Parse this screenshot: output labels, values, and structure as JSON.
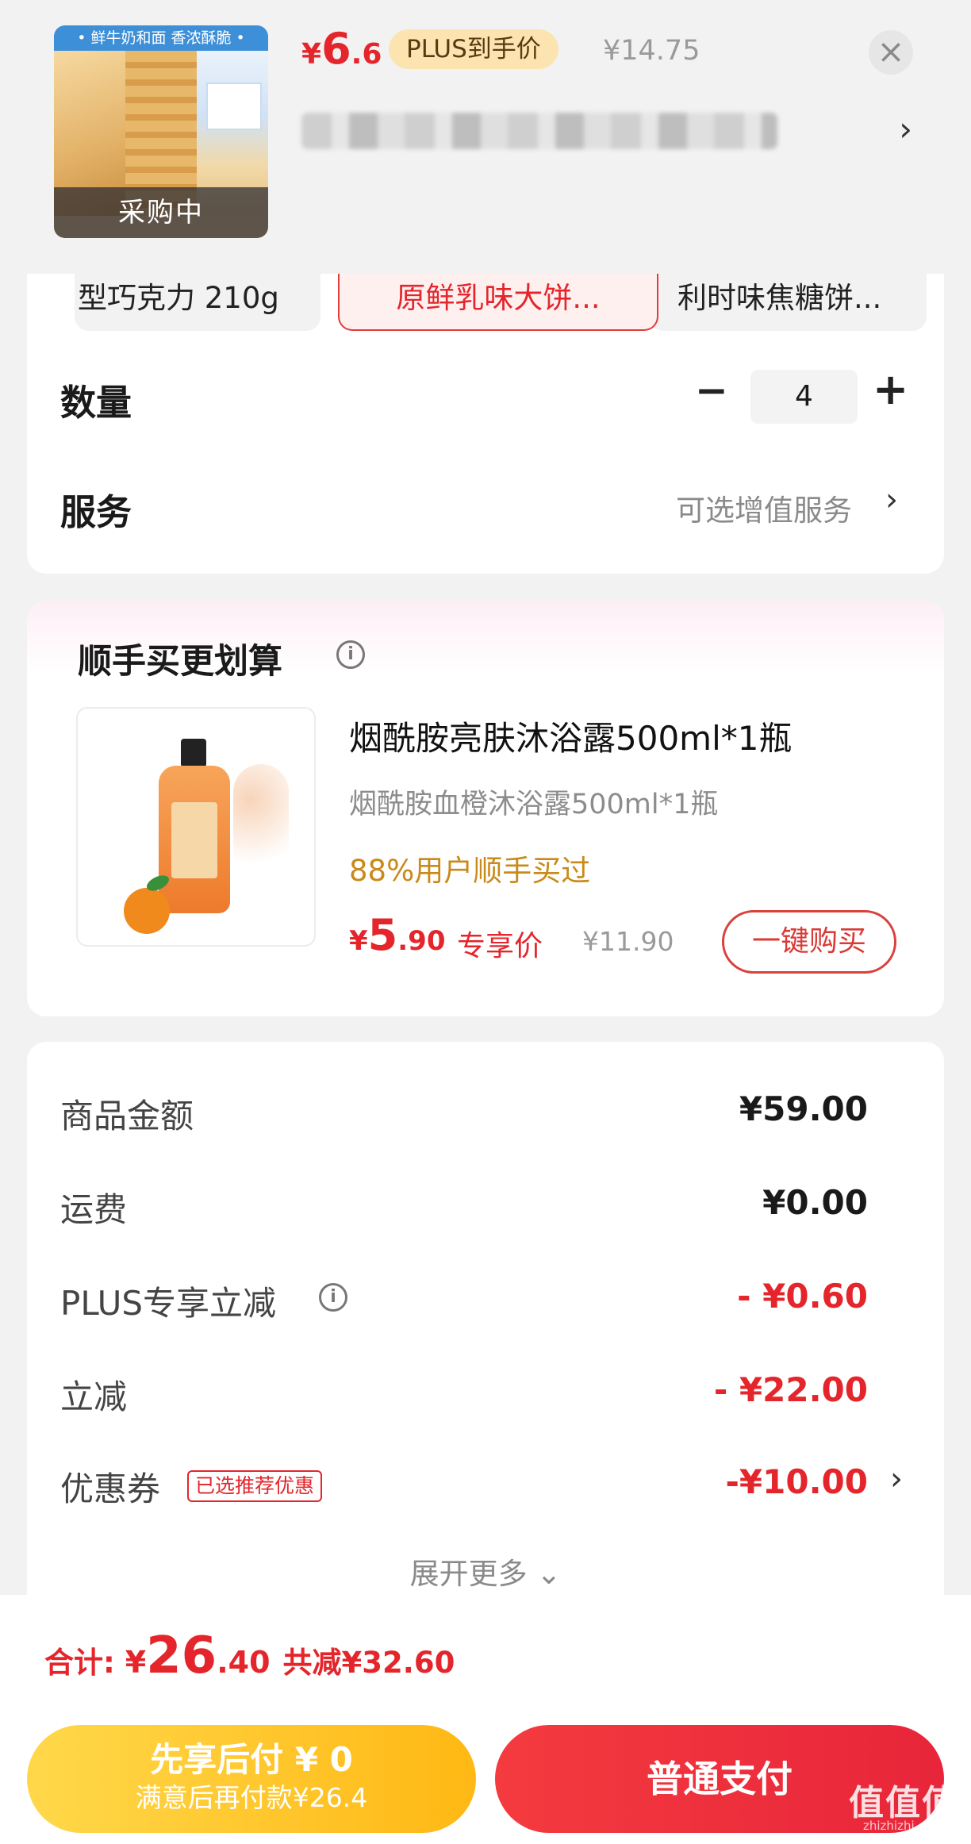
{
  "product": {
    "banner": "• 鲜牛奶和面 香浓酥脆 •",
    "status_overlay": "采购中",
    "price_yen": "¥",
    "price_int": "6",
    "price_dec": ".6",
    "plus_badge": "PLUS到手价",
    "original_price": "¥14.75",
    "close_icon": "close-icon",
    "address_arrow": "›"
  },
  "options": {
    "variants": [
      "型巧克力 210g",
      "原鲜乳味大饼...",
      "利时味焦糖饼..."
    ],
    "selected_index": 1,
    "quantity_label": "数量",
    "quantity_minus": "−",
    "quantity_value": "4",
    "quantity_plus": "+",
    "service_label": "服务",
    "service_value": "可选增值服务",
    "service_arrow": "›"
  },
  "addon": {
    "title": "顺手买更划算",
    "info_icon": "i",
    "product_title": "烟酰胺亮肤沐浴露500ml*1瓶",
    "product_sub": "烟酰胺血橙沐浴露500ml*1瓶",
    "stat": "88%用户顺手买过",
    "price_yen": "¥",
    "price_int": "5",
    "price_dec": ".90",
    "price_tag": "专享价",
    "original_price": "¥11.90",
    "buy_button": "一键购买"
  },
  "fees": {
    "items": [
      {
        "label": "商品金额",
        "value": "¥59.00"
      },
      {
        "label": "运费",
        "value": "¥0.00"
      },
      {
        "label": "PLUS专享立减",
        "value": "- ¥0.60"
      },
      {
        "label": "立减",
        "value": "- ¥22.00"
      },
      {
        "label": "优惠券",
        "value": "-¥10.00"
      }
    ],
    "coupon_tag": "已选推荐优惠",
    "info_icon": "i",
    "coupon_arrow": "›",
    "expand": "展开更多 ⌄"
  },
  "footer": {
    "total_label": "合计: ",
    "total_yen": "¥",
    "total_int": "26",
    "total_dec": ".40",
    "saved": "共减¥32.60",
    "pay_later_line1": "先享后付 ¥ 0",
    "pay_later_line2": "满意后再付款¥26.4",
    "pay_normal": "普通支付"
  },
  "watermark": {
    "text": "值值值",
    "sub": "zhizhizhi.com"
  },
  "colors": {
    "accent_red": "#e4262c",
    "gold": "#c98a1a",
    "pay_later_yellow": "#ffc21f",
    "plus_badge_bg": "#fbe4b0"
  }
}
